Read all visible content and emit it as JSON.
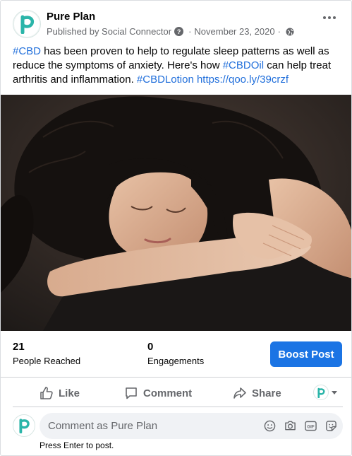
{
  "post": {
    "page_name": "Pure Plan",
    "published_by": "Published by Social Connector",
    "date": "November 23, 2020",
    "text": {
      "tag1": "#CBD",
      "part1": " has been proven to help to regulate sleep patterns as well as reduce the symptoms of anxiety. Here's how ",
      "tag2": "#CBDOil",
      "part2": " can help treat arthritis and inflammation. ",
      "tag3": "#CBDLotion",
      "link": "https://qoo.ly/39crzf"
    }
  },
  "stats": {
    "reached_value": "21",
    "reached_label": "People Reached",
    "engagements_value": "0",
    "engagements_label": "Engagements",
    "boost_label": "Boost Post"
  },
  "actions": {
    "like": "Like",
    "comment": "Comment",
    "share": "Share"
  },
  "comment": {
    "placeholder": "Comment as Pure Plan",
    "hint": "Press Enter to post."
  },
  "icons": {
    "avatar": "pure-plan-logo-icon",
    "info": "question-icon",
    "audience": "globe-icon",
    "more": "more-options-icon",
    "like": "thumbs-up-icon",
    "comment": "speech-bubble-icon",
    "share": "share-arrow-icon",
    "emoji": "smiley-icon",
    "camera": "camera-icon",
    "gif": "gif-icon",
    "sticker": "sticker-icon"
  },
  "colors": {
    "link": "#216fdb",
    "boost": "#1b74e4",
    "brand_teal": "#2bb5a9"
  }
}
